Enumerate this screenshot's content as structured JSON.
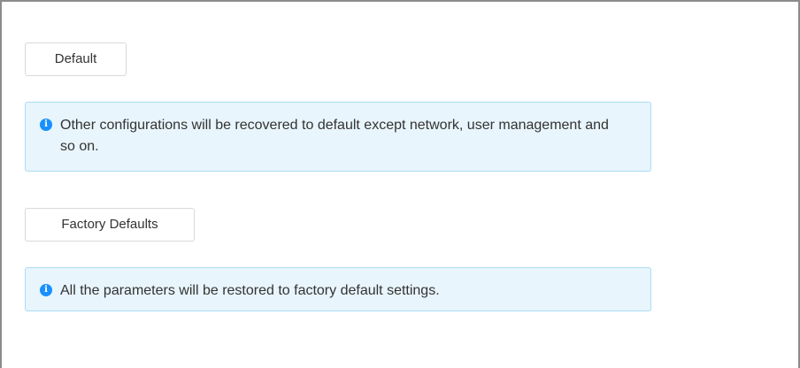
{
  "default_section": {
    "button_label": "Default",
    "info_icon": "info-circle-icon",
    "message": "Other configurations will be recovered to default except network, user management and so on."
  },
  "factory_section": {
    "button_label": "Factory Defaults",
    "info_icon": "info-circle-icon",
    "message": "All the parameters will be restored to factory default settings."
  },
  "colors": {
    "info_background": "#e8f5fc",
    "info_border": "#acdcf4",
    "info_icon": "#1890ff"
  }
}
